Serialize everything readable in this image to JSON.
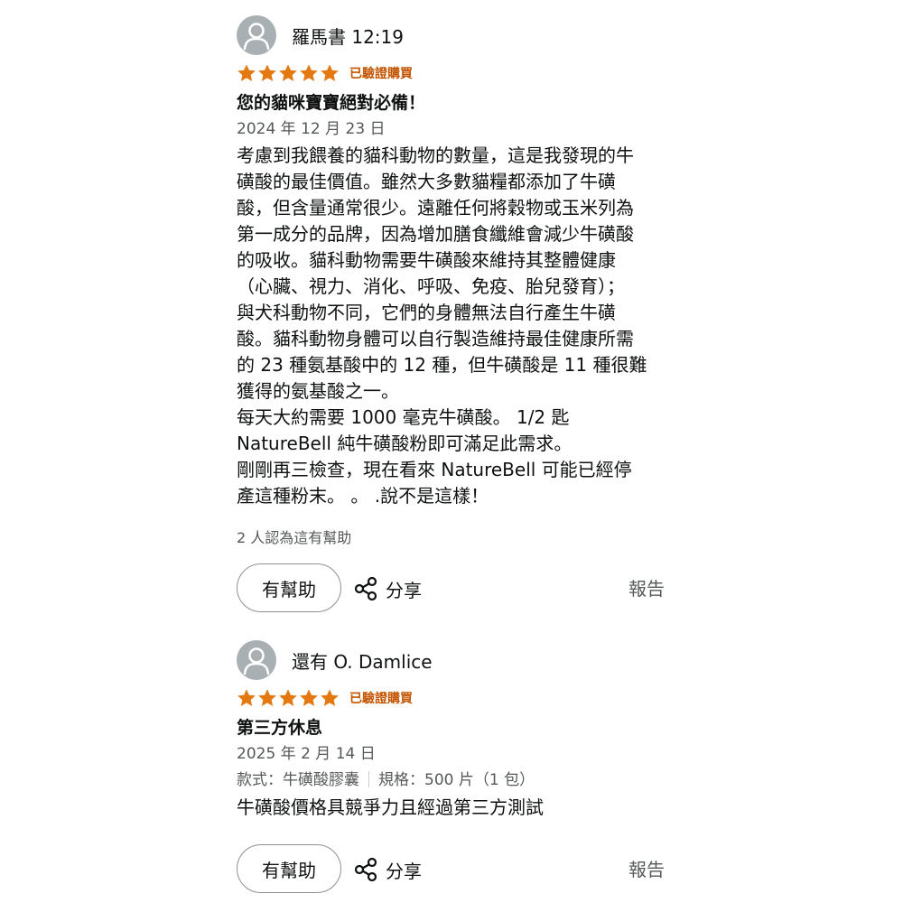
{
  "reviews": [
    {
      "author": "羅馬書 12:19",
      "rating": 5,
      "verified_label": "已驗證購買",
      "title": "您的貓咪寶寶絕對必備！",
      "date": "2024 年 12 月 23 日",
      "body_lines": [
        "考慮到我餵養的貓科動物的數量，這是我發現的牛",
        "磺酸的最佳價值。雖然大多數貓糧都添加了牛磺",
        "酸，但含量通常很少。遠離任何將穀物或玉米列為",
        "第一成分的品牌，因為增加膳食纖維會減少牛磺酸",
        "的吸收。貓科動物需要牛磺酸來維持其整體健康",
        "（心臟、視力、消化、呼吸、免疫、胎兒發育）；",
        "與犬科動物不同，它們的身體無法自行產生牛磺",
        "酸。貓科動物身體可以自行製造維持最佳健康所需",
        "的 23 種氨基酸中的 12 種，但牛磺酸是 11 種很難",
        "獲得的氨基酸之一。",
        "每天大約需要 1000 毫克牛磺酸。 1/2 匙",
        "NatureBell 純牛磺酸粉即可滿足此需求。",
        "剛剛再三檢查，現在看來 NatureBell 可能已經停",
        "產這種粉末。 。 .說不是這樣！"
      ],
      "helpful_count": "2 人認為這有幫助",
      "helpful_button": "有幫助",
      "share_label": "分享",
      "report_label": "報告"
    },
    {
      "author": "還有 O. Damlice",
      "rating": 5,
      "verified_label": "已驗證購買",
      "title": "第三方休息",
      "date": "2025 年 2 月 14 日",
      "format_style": "款式：牛磺酸膠囊",
      "format_size": "規格：500 片（1 包）",
      "body_lines": [
        "牛磺酸價格具競爭力且經過第三方測試"
      ],
      "helpful_button": "有幫助",
      "share_label": "分享",
      "report_label": "報告"
    }
  ],
  "colors": {
    "star": "#e47911",
    "verified": "#c45500",
    "avatar": "#a9b0b4",
    "text": "#0f1111",
    "secondary_text": "#565959"
  },
  "icons": {
    "avatar": "person-silhouette-icon",
    "star": "star-icon",
    "share": "share-icon"
  }
}
